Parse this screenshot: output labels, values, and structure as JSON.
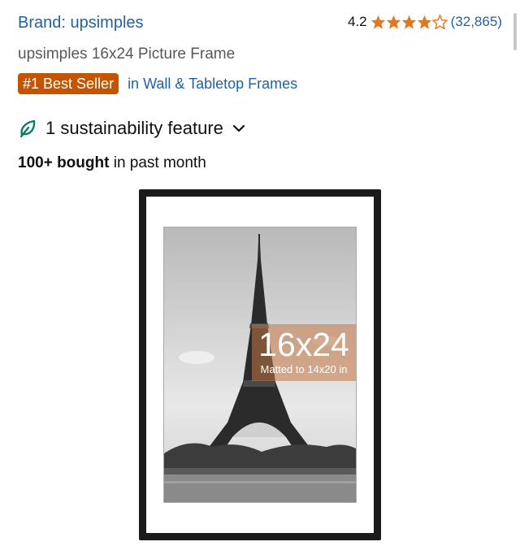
{
  "header": {
    "brand_label": "Brand: upsimples",
    "rating_value": "4.2",
    "rating_stars": 4.2,
    "rating_max": 5,
    "review_count": "(32,865)"
  },
  "product": {
    "title": "upsimples 16x24 Picture Frame",
    "bestseller_badge": "#1 Best Seller",
    "category_link": "in Wall & Tabletop Frames",
    "sustainability_label": "1 sustainability feature",
    "bought_bold": "100+ bought",
    "bought_rest": " in past month"
  },
  "image": {
    "size_label": "16x24",
    "matted_label": "Matted to 14x20 in"
  },
  "colors": {
    "link": "#2162a1",
    "badge": "#c45500",
    "star": "#de7921",
    "leaf": "#067d62"
  },
  "icons": {
    "star_full": "star-icon",
    "star_empty": "star-outline-icon",
    "leaf": "leaf-icon",
    "chevron": "chevron-down-icon"
  }
}
